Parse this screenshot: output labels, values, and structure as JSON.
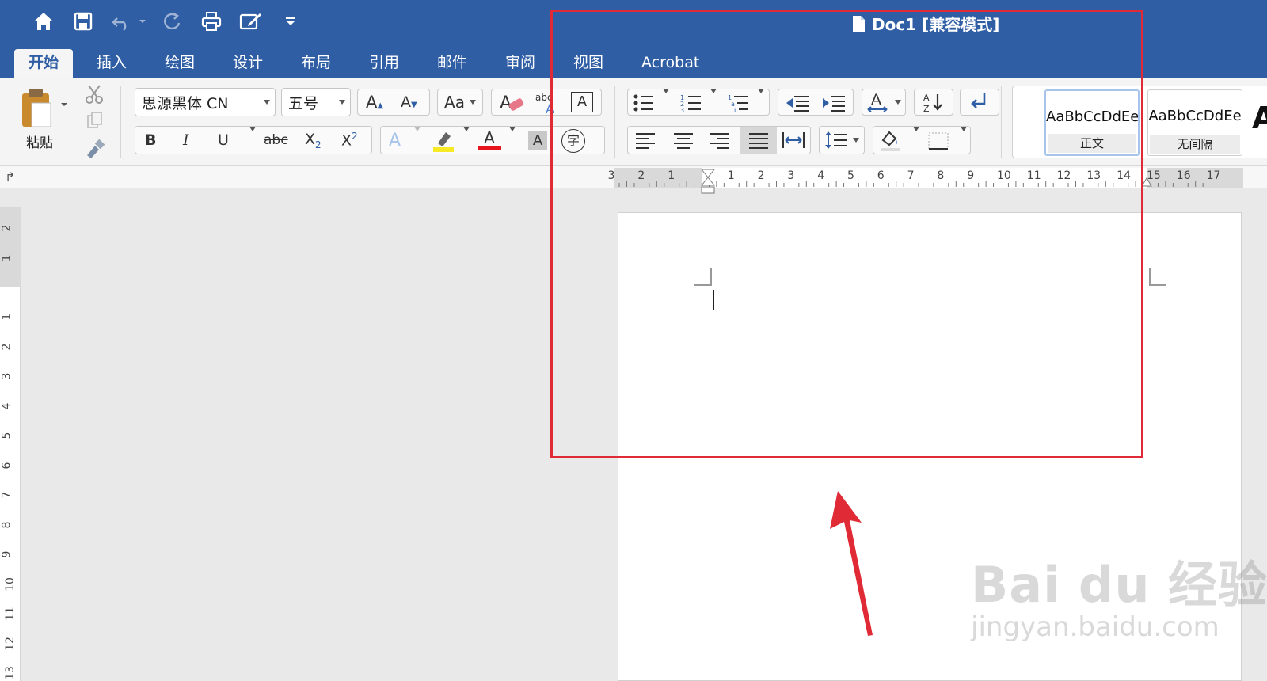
{
  "app": {
    "document_title": "Doc1 [兼容模式]"
  },
  "quick_access": [
    "home-icon",
    "save-icon",
    "undo-icon",
    "redo-icon",
    "print-icon",
    "edit-doc-icon",
    "customize-icon"
  ],
  "tabs": [
    {
      "label": "开始",
      "active": true
    },
    {
      "label": "插入",
      "active": false
    },
    {
      "label": "绘图",
      "active": false
    },
    {
      "label": "设计",
      "active": false
    },
    {
      "label": "布局",
      "active": false
    },
    {
      "label": "引用",
      "active": false
    },
    {
      "label": "邮件",
      "active": false
    },
    {
      "label": "审阅",
      "active": false
    },
    {
      "label": "视图",
      "active": false
    },
    {
      "label": "Acrobat",
      "active": false
    }
  ],
  "clipboard": {
    "paste_label": "粘贴"
  },
  "font": {
    "name": "思源黑体 CN",
    "size": "五号",
    "superscript_text": "2",
    "subscript_text": "2"
  },
  "buttons": {
    "bold": "B",
    "italic": "I",
    "underline": "U",
    "strikethrough": "abc",
    "subscript": "X",
    "superscript": "X",
    "grow_font": "A",
    "shrink_font": "A",
    "change_case": "Aa",
    "text_effects": "A",
    "font_color": "A",
    "char_shading": "A",
    "phonetic": "字",
    "char_border": "A"
  },
  "styles": [
    {
      "sample": "AaBbCcDdEe",
      "label": "正文",
      "selected": true
    },
    {
      "sample": "AaBbCcDdEe",
      "label": "无间隔",
      "selected": false
    }
  ],
  "ruler": {
    "h_left": [
      "3",
      "2",
      "1"
    ],
    "h_right": [
      "1",
      "2",
      "3",
      "4",
      "5",
      "6",
      "7",
      "8",
      "9",
      "10",
      "11",
      "12",
      "13",
      "14",
      "15",
      "16",
      "17"
    ],
    "v_top": [
      "2",
      "1"
    ],
    "v_main": [
      "1",
      "2",
      "3",
      "4",
      "5",
      "6",
      "7",
      "8",
      "9",
      "10",
      "11",
      "12",
      "13"
    ]
  },
  "watermark": {
    "main": "Bai  du 经验",
    "sub": "jingyan.baidu.com"
  },
  "colors": {
    "titlebar": "#2f5ea5",
    "highlight": "#e02a35",
    "arrow": "#e02a35",
    "font_color_bar": "#e8141c",
    "highlighter_bar": "#f7ea24"
  }
}
